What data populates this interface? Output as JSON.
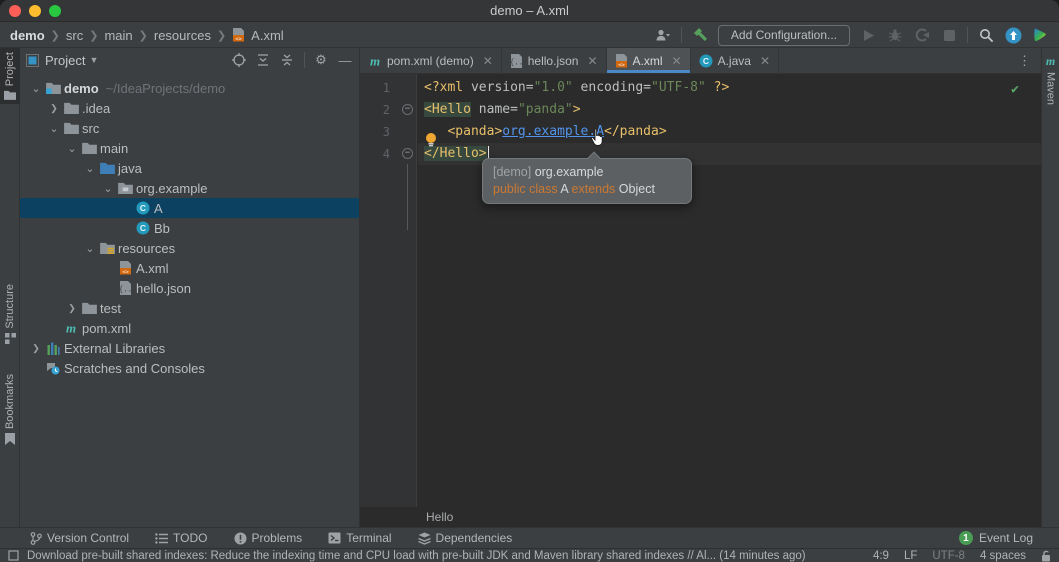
{
  "window": {
    "title": "demo – A.xml"
  },
  "nav": {
    "breadcrumbs": [
      "demo",
      "src",
      "main",
      "resources",
      "A.xml"
    ],
    "add_configuration_label": "Add Configuration..."
  },
  "left_stripe": {
    "project_label": "Project",
    "structure_label": "Structure",
    "bookmarks_label": "Bookmarks"
  },
  "project_panel": {
    "title": "Project",
    "tree": [
      {
        "label": "demo",
        "hint": "~/IdeaProjects/demo",
        "icon": "project-folder",
        "indent": 0,
        "chevron": "open",
        "bold": true
      },
      {
        "label": ".idea",
        "icon": "folder",
        "indent": 1,
        "chevron": "closed"
      },
      {
        "label": "src",
        "icon": "folder",
        "indent": 1,
        "chevron": "open"
      },
      {
        "label": "main",
        "icon": "folder",
        "indent": 2,
        "chevron": "open"
      },
      {
        "label": "java",
        "icon": "src-folder",
        "indent": 3,
        "chevron": "open"
      },
      {
        "label": "org.example",
        "icon": "package",
        "indent": 4,
        "chevron": "open"
      },
      {
        "label": "A",
        "icon": "class",
        "indent": 5,
        "selected": true
      },
      {
        "label": "Bb",
        "icon": "class",
        "indent": 5
      },
      {
        "label": "resources",
        "icon": "resources-folder",
        "indent": 3,
        "chevron": "open"
      },
      {
        "label": "A.xml",
        "icon": "xml-file",
        "indent": 4
      },
      {
        "label": "hello.json",
        "icon": "json-file",
        "indent": 4
      },
      {
        "label": "test",
        "icon": "folder",
        "indent": 2,
        "chevron": "closed"
      },
      {
        "label": "pom.xml",
        "icon": "maven",
        "indent": 1
      },
      {
        "label": "External Libraries",
        "icon": "libraries",
        "indent": 0,
        "chevron": "closed"
      },
      {
        "label": "Scratches and Consoles",
        "icon": "scratches",
        "indent": 0
      }
    ]
  },
  "editor": {
    "tabs": [
      {
        "label": "pom.xml (demo)",
        "icon": "maven",
        "active": false
      },
      {
        "label": "hello.json",
        "icon": "json-file",
        "active": false
      },
      {
        "label": "A.xml",
        "icon": "xml-file",
        "active": true
      },
      {
        "label": "A.java",
        "icon": "class",
        "active": false
      }
    ],
    "code_lines": [
      {
        "num": "1",
        "segments": [
          {
            "text": "<?xml",
            "style": "tag"
          },
          {
            "text": " ",
            "style": "attr"
          },
          {
            "text": "version=",
            "style": "attr"
          },
          {
            "text": "\"1.0\"",
            "style": "str"
          },
          {
            "text": " encoding=",
            "style": "attr"
          },
          {
            "text": "\"UTF-8\"",
            "style": "str"
          },
          {
            "text": " ?>",
            "style": "tag"
          }
        ]
      },
      {
        "num": "2",
        "segments": [
          {
            "text": "<Hello",
            "style": "tag hl"
          },
          {
            "text": " name=",
            "style": "attr"
          },
          {
            "text": "\"panda\"",
            "style": "str"
          },
          {
            "text": ">",
            "style": "tag"
          }
        ]
      },
      {
        "num": "3",
        "segments": [
          {
            "text": "   ",
            "style": "attr"
          },
          {
            "text": "<panda>",
            "style": "tag"
          },
          {
            "text": "org.example.A",
            "style": "link"
          },
          {
            "text": "</panda>",
            "style": "tag"
          }
        ]
      },
      {
        "num": "4",
        "current": true,
        "caret": true,
        "segments": [
          {
            "text": "</Hello>",
            "style": "tag hl"
          }
        ]
      }
    ],
    "breadcrumb": "Hello",
    "tooltip": {
      "line1": [
        {
          "text": "[demo] ",
          "style": "dim"
        },
        {
          "text": "org.example",
          "style": "plain"
        }
      ],
      "line2": [
        {
          "text": "public class ",
          "style": "kw"
        },
        {
          "text": "A ",
          "style": "plain"
        },
        {
          "text": "extends ",
          "style": "kw"
        },
        {
          "text": "Object",
          "style": "plain"
        }
      ]
    }
  },
  "right_stripe": {
    "maven_label": "Maven"
  },
  "bottom_bar": {
    "tools": [
      {
        "label": "Version Control",
        "icon": "branch"
      },
      {
        "label": "TODO",
        "icon": "todo"
      },
      {
        "label": "Problems",
        "icon": "problems"
      },
      {
        "label": "Terminal",
        "icon": "terminal"
      },
      {
        "label": "Dependencies",
        "icon": "dependencies"
      }
    ],
    "event_log_label": "Event Log",
    "event_log_badge": "1"
  },
  "status_bar": {
    "message": "Download pre-built shared indexes: Reduce the indexing time and CPU load with pre-built JDK and Maven library shared indexes // Al... (14 minutes ago)",
    "right_items": [
      {
        "text": "4:9"
      },
      {
        "text": "LF"
      },
      {
        "text": "UTF-8",
        "dim": true
      },
      {
        "text": "4 spaces"
      }
    ]
  },
  "colors": {
    "accent_blue": "#4a88c7",
    "selection_blue": "#0d4161",
    "tag_yellow": "#e8bf6a",
    "string_green": "#6a8759",
    "keyword_orange": "#cc7832",
    "event_green": "#499c54"
  }
}
